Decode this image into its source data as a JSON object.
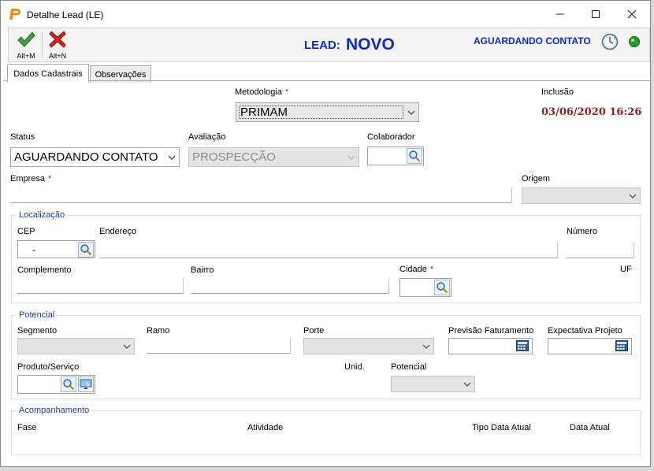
{
  "window": {
    "title": "Detalhe Lead (LE)",
    "controls": [
      "minimize-icon",
      "maximize-icon",
      "close-icon"
    ]
  },
  "toolbar": {
    "confirm": {
      "shortcut": "Alt+M",
      "icon": "checkmark-icon",
      "color": "#3aa43a"
    },
    "cancel": {
      "shortcut": "Alt+N",
      "icon": "x-icon",
      "color": "#d92020"
    },
    "lead_label": "LEAD:",
    "lead_value": "NOVO",
    "status": "AGUARDANDO CONTATO",
    "status_light_color": "#24a024",
    "accent_color": "#0b2ad4"
  },
  "tabs": [
    {
      "label": "Dados Cadastrais",
      "active": true
    },
    {
      "label": "Observações",
      "active": false
    }
  ],
  "form": {
    "metodologia": {
      "label": "Metodologia",
      "value": "PRIMAM"
    },
    "inclusao": {
      "label": "Inclusão",
      "value": "03/06/2020 16:26",
      "color": "#a01818"
    },
    "status": {
      "label": "Status",
      "value": "AGUARDANDO CONTATO"
    },
    "avaliacao": {
      "label": "Avaliação",
      "value": "PROSPECÇÃO"
    },
    "colaborador": {
      "label": "Colaborador",
      "value": ""
    },
    "empresa": {
      "label": "Empresa",
      "value": ""
    },
    "origem": {
      "label": "Origem",
      "value": ""
    },
    "required_mark": "*"
  },
  "localizacao": {
    "legend": "Localização",
    "cep": {
      "label": "CEP",
      "value": "-"
    },
    "endereco": {
      "label": "Endereço",
      "value": ""
    },
    "numero": {
      "label": "Número",
      "value": ""
    },
    "complemento": {
      "label": "Complemento",
      "value": ""
    },
    "bairro": {
      "label": "Bairro",
      "value": ""
    },
    "cidade": {
      "label": "Cidade",
      "value": ""
    },
    "uf": {
      "label": "UF",
      "value": ""
    }
  },
  "potencial": {
    "legend": "Potencial",
    "segmento": {
      "label": "Segmento",
      "value": ""
    },
    "ramo": {
      "label": "Ramo",
      "value": ""
    },
    "porte": {
      "label": "Porte",
      "value": ""
    },
    "previsao": {
      "label": "Previsão Faturamento",
      "value": ""
    },
    "expectativa": {
      "label": "Expectativa Projeto",
      "value": ""
    },
    "produto": {
      "label": "Produto/Serviço",
      "value": ""
    },
    "unid": {
      "label": "Unid."
    },
    "potencial": {
      "label": "Potencial",
      "value": ""
    }
  },
  "acompanhamento": {
    "legend": "Acompanhamento",
    "columns": [
      "Fase",
      "Atividade",
      "Tipo Data Atual",
      "Data Atual"
    ]
  }
}
